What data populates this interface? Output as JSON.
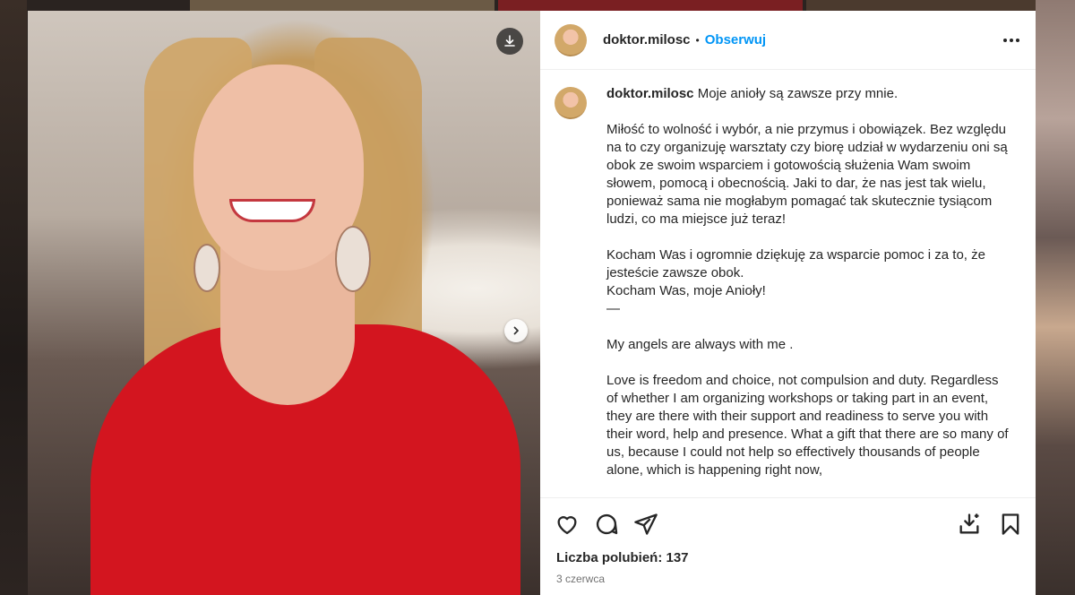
{
  "post": {
    "author": "doktor.milosc",
    "separator": "•",
    "follow_label": "Obserwuj",
    "caption_first_line": "Moje anioły są zawsze przy mnie.",
    "caption_body": "\nMiłość to wolność i wybór, a nie przymus i obowiązek. Bez względu na to czy organizuję warsztaty czy biorę udział w wydarzeniu oni są obok ze swoim wsparciem i gotowością służenia Wam swoim słowem, pomocą i obecnością. Jaki to dar, że nas jest tak wielu, ponieważ sama nie mogłabym pomagać tak skutecznie tysiącom ludzi, co ma miejsce już teraz!\n\nKocham Was i ogromnie dziękuję za wsparcie pomoc i za to, że jesteście zawsze obok.\nKocham Was, moje Anioły!\n—\n\nMy angels are always with me .\n\nLove is freedom and choice, not compulsion and duty. Regardless of whether I am organizing workshops or taking part in an event, they are there with their support and readiness to serve you with their word, help and presence. What a gift that there are so many of us, because I could not help so effectively thousands of people alone, which is happening right now,",
    "likes_label": "Liczba polubień: 137",
    "date": "3 czerwca"
  },
  "icons": {
    "download": "download-icon",
    "next": "chevron-right-icon",
    "more": "more-options-icon",
    "like": "heart-icon",
    "comment": "comment-icon",
    "share": "send-icon",
    "save_download": "save-to-device-icon",
    "bookmark": "bookmark-icon"
  },
  "colors": {
    "accent": "#0095f6",
    "text": "#262626",
    "muted": "#737373",
    "dress": "#d3151f"
  }
}
